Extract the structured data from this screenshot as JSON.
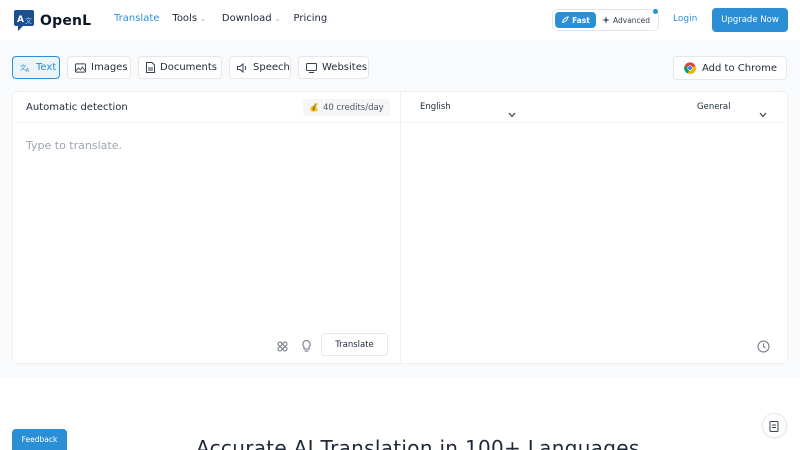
{
  "brand": {
    "name": "OpenL",
    "accent": "#2b8fd6"
  },
  "nav": {
    "items": [
      {
        "label": "Translate",
        "active": true
      },
      {
        "label": "Tools",
        "dropdown": true
      },
      {
        "label": "Download",
        "dropdown": true
      },
      {
        "label": "Pricing"
      }
    ]
  },
  "modes": {
    "fast": "Fast",
    "advanced": "Advanced"
  },
  "header": {
    "login": "Login",
    "upgrade": "Upgrade Now"
  },
  "tabs": [
    {
      "label": "Text",
      "icon": "translate-icon",
      "active": true
    },
    {
      "label": "Images",
      "icon": "image-icon"
    },
    {
      "label": "Documents",
      "icon": "document-icon"
    },
    {
      "label": "Speech",
      "icon": "speaker-icon"
    },
    {
      "label": "Websites",
      "icon": "monitor-icon"
    }
  ],
  "chrome": {
    "label": "Add to Chrome"
  },
  "source": {
    "language": "Automatic detection",
    "credits": "40 credits/day",
    "placeholder": "Type to translate.",
    "translate_button": "Translate"
  },
  "target": {
    "language": "English",
    "domain": "General"
  },
  "bottom": {
    "heading": "Accurate AI Translation in 100+ Languages",
    "feedback": "Feedback"
  }
}
